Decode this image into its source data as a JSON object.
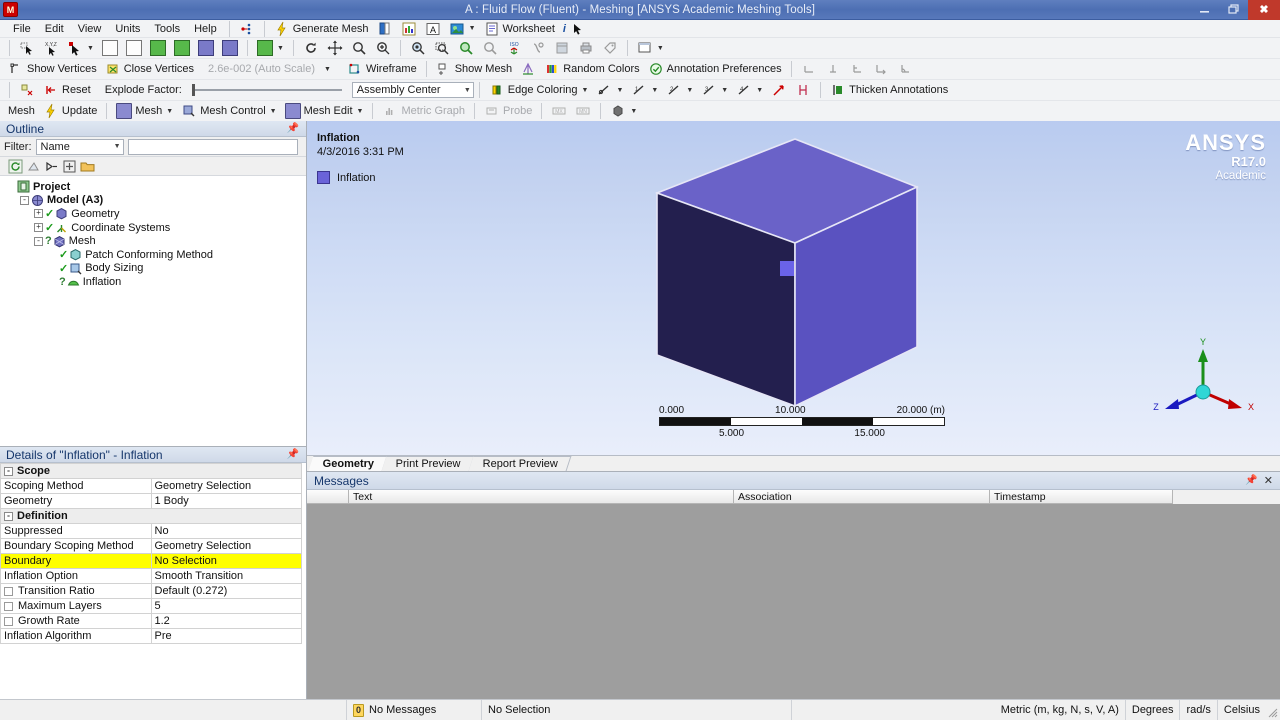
{
  "window": {
    "title": "A : Fluid Flow (Fluent) - Meshing [ANSYS Academic Meshing Tools]",
    "logo_letter": "M",
    "minimize": "minimize-icon",
    "restore": "restore-icon",
    "close": "✖"
  },
  "menubar": {
    "items": [
      "File",
      "Edit",
      "View",
      "Units",
      "Tools",
      "Help"
    ]
  },
  "toolbar_main": {
    "generate_mesh": "Generate Mesh",
    "worksheet": "Worksheet",
    "info": "i"
  },
  "toolbar_display": {
    "show_vertices": "Show Vertices",
    "close_vertices": "Close Vertices",
    "auto_scale": "2.6e-002 (Auto Scale)",
    "wireframe": "Wireframe",
    "show_mesh": "Show Mesh",
    "random_colors": "Random Colors",
    "annotation_preferences": "Annotation Preferences"
  },
  "toolbar_explode": {
    "reset": "Reset",
    "explode_factor_label": "Explode Factor:",
    "assembly_center": "Assembly Center",
    "edge_coloring": "Edge Coloring",
    "thicken_annotations": "Thicken Annotations"
  },
  "toolbar_mesh": {
    "mesh_label": "Mesh",
    "update": "Update",
    "mesh": "Mesh",
    "mesh_control": "Mesh Control",
    "mesh_edit": "Mesh Edit",
    "metric_graph": "Metric Graph",
    "probe": "Probe"
  },
  "outline": {
    "header": "Outline",
    "filter_label": "Filter:",
    "filter_value": "Name",
    "filter_text": "",
    "tree": [
      {
        "label": "Project",
        "depth": 0,
        "bold": true,
        "expander": "",
        "icon": "project-icon",
        "status": ""
      },
      {
        "label": "Model (A3)",
        "depth": 1,
        "bold": true,
        "expander": "-",
        "icon": "model-icon",
        "status": ""
      },
      {
        "label": "Geometry",
        "depth": 2,
        "bold": false,
        "expander": "+",
        "icon": "geometry-icon",
        "status": "check"
      },
      {
        "label": "Coordinate Systems",
        "depth": 2,
        "bold": false,
        "expander": "+",
        "icon": "coordinate-systems-icon",
        "status": "check"
      },
      {
        "label": "Mesh",
        "depth": 2,
        "bold": false,
        "expander": "-",
        "icon": "mesh-icon",
        "status": "question"
      },
      {
        "label": "Patch Conforming Method",
        "depth": 3,
        "bold": false,
        "expander": "",
        "icon": "method-icon",
        "status": "check"
      },
      {
        "label": "Body Sizing",
        "depth": 3,
        "bold": false,
        "expander": "",
        "icon": "sizing-icon",
        "status": "check"
      },
      {
        "label": "Inflation",
        "depth": 3,
        "bold": false,
        "expander": "",
        "icon": "inflation-icon",
        "status": "question"
      }
    ]
  },
  "details": {
    "header": "Details of \"Inflation\" - Inflation",
    "rows": [
      {
        "kind": "section",
        "label": "Scope",
        "value": ""
      },
      {
        "kind": "row",
        "label": "Scoping Method",
        "value": "Geometry Selection"
      },
      {
        "kind": "row",
        "label": "Geometry",
        "value": "1 Body"
      },
      {
        "kind": "section",
        "label": "Definition",
        "value": ""
      },
      {
        "kind": "row",
        "label": "Suppressed",
        "value": "No"
      },
      {
        "kind": "row",
        "label": "Boundary Scoping Method",
        "value": "Geometry Selection"
      },
      {
        "kind": "highlight",
        "label": "Boundary",
        "value": "No Selection"
      },
      {
        "kind": "row",
        "label": "Inflation Option",
        "value": "Smooth Transition"
      },
      {
        "kind": "check",
        "label": "Transition Ratio",
        "value": "Default (0.272)"
      },
      {
        "kind": "check",
        "label": "Maximum Layers",
        "value": "5"
      },
      {
        "kind": "check",
        "label": "Growth Rate",
        "value": "1.2"
      },
      {
        "kind": "row",
        "label": "Inflation Algorithm",
        "value": "Pre"
      }
    ]
  },
  "viewport": {
    "annotation_title": "Inflation",
    "annotation_date": "4/3/2016 3:31 PM",
    "legend_label": "Inflation",
    "legend_color": "#6a63d8",
    "watermark_line1": "ANSYS",
    "watermark_line2": "R17.0",
    "watermark_line3": "Academic",
    "cursor": "rotate-cursor-icon",
    "scale": {
      "left": "0.000",
      "mid": "10.000",
      "right": "20.000 (m)",
      "lower_left": "5.000",
      "lower_right": "15.000"
    },
    "triad": {
      "x": "X",
      "y": "Y",
      "z": "Z"
    },
    "tabs": [
      {
        "label": "Geometry",
        "active": true
      },
      {
        "label": "Print Preview",
        "active": false
      },
      {
        "label": "Report Preview",
        "active": false
      }
    ]
  },
  "messages": {
    "header": "Messages",
    "columns": [
      "",
      "Text",
      "Association",
      "Timestamp"
    ],
    "rows": []
  },
  "statusbar": {
    "message_count": "0",
    "message_text": "No Messages",
    "selection": "No Selection",
    "units": "Metric (m, kg, N, s, V, A)",
    "angle": "Degrees",
    "rotation": "rad/s",
    "temperature": "Celsius"
  }
}
